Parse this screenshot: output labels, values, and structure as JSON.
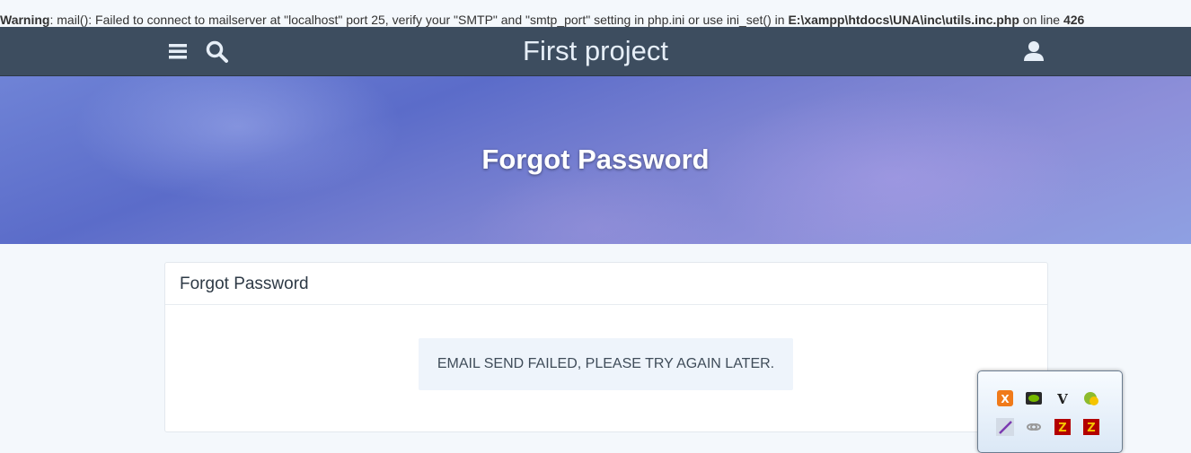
{
  "warning": {
    "label": "Warning",
    "message": ": mail(): Failed to connect to mailserver at \"localhost\" port 25, verify your \"SMTP\" and \"smtp_port\" setting in php.ini or use ini_set() in ",
    "file": "E:\\xampp\\htdocs\\UNA\\inc\\utils.inc.php",
    "on_line": " on line ",
    "line": "426"
  },
  "header": {
    "site_title": "First project",
    "menu_icon": "hamburger-menu-icon",
    "search_icon": "search-icon",
    "account_icon": "user-icon"
  },
  "hero": {
    "title": "Forgot Password"
  },
  "card": {
    "title": "Forgot Password",
    "message": "EMAIL SEND FAILED, PLEASE TRY AGAIN LATER."
  },
  "tray": {
    "icons": [
      "xampp-icon",
      "nvidia-icon",
      "vim-icon",
      "update-icon",
      "pen-icon",
      "link-icon",
      "filezilla-icon",
      "filezilla-icon"
    ]
  },
  "colors": {
    "topbar": "#3d4d5f",
    "hero_accent": "#6f83d6",
    "background": "#f4f8fc",
    "message_bg": "#eef4fb"
  }
}
